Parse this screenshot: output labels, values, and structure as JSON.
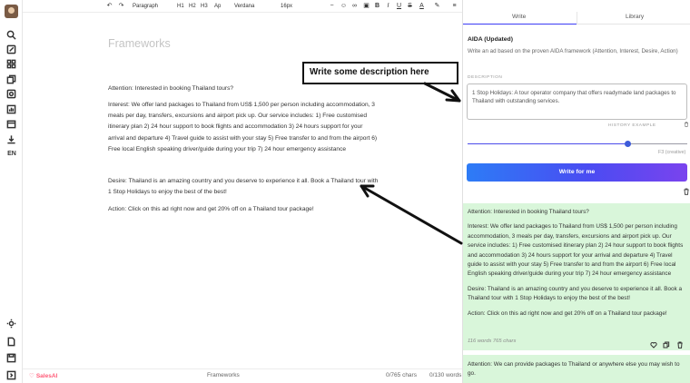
{
  "toolbar": {
    "undo": "↶",
    "redo": "↷",
    "paragraph": "Paragraph",
    "h1": "H1",
    "h2": "H2",
    "h3": "H3",
    "font_style": "Ap",
    "font_family": "Verdana",
    "font_size": "16px",
    "bold": "B",
    "italic": "I",
    "underline": "U",
    "strike": "S",
    "text_color": "A"
  },
  "sidebar": {
    "language": "EN"
  },
  "editor": {
    "title": "Frameworks",
    "paragraphs": [
      "Attention: Interested in booking Thailand tours?",
      "Interest: We offer land packages to Thailand from US$ 1,500 per person including accommodation, 3 meals per day, transfers, excursions and airport pick up. Our service includes: 1) Free customised itinerary plan 2) 24 hour support to book flights and accommodation 3) 24 hours support for your arrival and departure 4) Travel guide to assist with your stay 5) Free transfer to and from the airport 6) Free local English speaking driver/guide during your trip 7) 24 hour emergency assistance",
      "Desire: Thailand is an amazing country and you deserve to experience it all. Book a Thailand tour with 1 Stop Holidays to enjoy the best of the best!",
      "Action: Click on this ad right now and get 20% off on a Thailand tour package!"
    ]
  },
  "footer": {
    "brand": "SalesAI",
    "doc_name": "Frameworks",
    "chars": "0/765 chars",
    "words": "0/130 words"
  },
  "panel": {
    "tabs": [
      "Write",
      "Library"
    ],
    "framework_title": "AIDA (Updated)",
    "framework_desc": "Write an ad based on the proven AIDA framework (Attention, Interest, Desire, Action)",
    "description_label": "DESCRIPTION",
    "description_value": "1 Stop Holidays: A tour operator company that offers readymade land packages to Thailand with outstanding services.",
    "history_label": "HISTORY EXAMPLE",
    "temperature_label": "F3 (creative)",
    "temperature_value": 0.73,
    "write_button": "Write for me",
    "result": {
      "paragraphs": [
        "Attention: Interested in booking Thailand tours?",
        "Interest: We offer land packages to Thailand from US$ 1,500 per person including accommodation, 3 meals per day, transfers, excursions and airport pick up. Our service includes: 1) Free customised itinerary plan 2) 24 hour support to book flights and accommodation 3) 24 hours support for your arrival and departure 4) Travel guide to assist with your stay 5) Free transfer to and from the airport 6) Free local English speaking driver/guide during your trip 7) 24 hour emergency assistance",
        "Desire: Thailand is an amazing country and you deserve to experience it all. Book a Thailand tour with 1 Stop Holidays to enjoy the best of the best!",
        "Action: Click on this ad right now and get 20% off on a Thailand tour package!"
      ],
      "meta": "116 words  765 chars"
    },
    "result2_text": "Attention: We can provide packages to Thailand or anywhere else you may wish to go."
  },
  "annotation": {
    "callout": "Write some description here"
  },
  "colors": {
    "accent": "#3b3bf5",
    "result_bg": "#d9f6da",
    "brand": "#ff5a77"
  }
}
